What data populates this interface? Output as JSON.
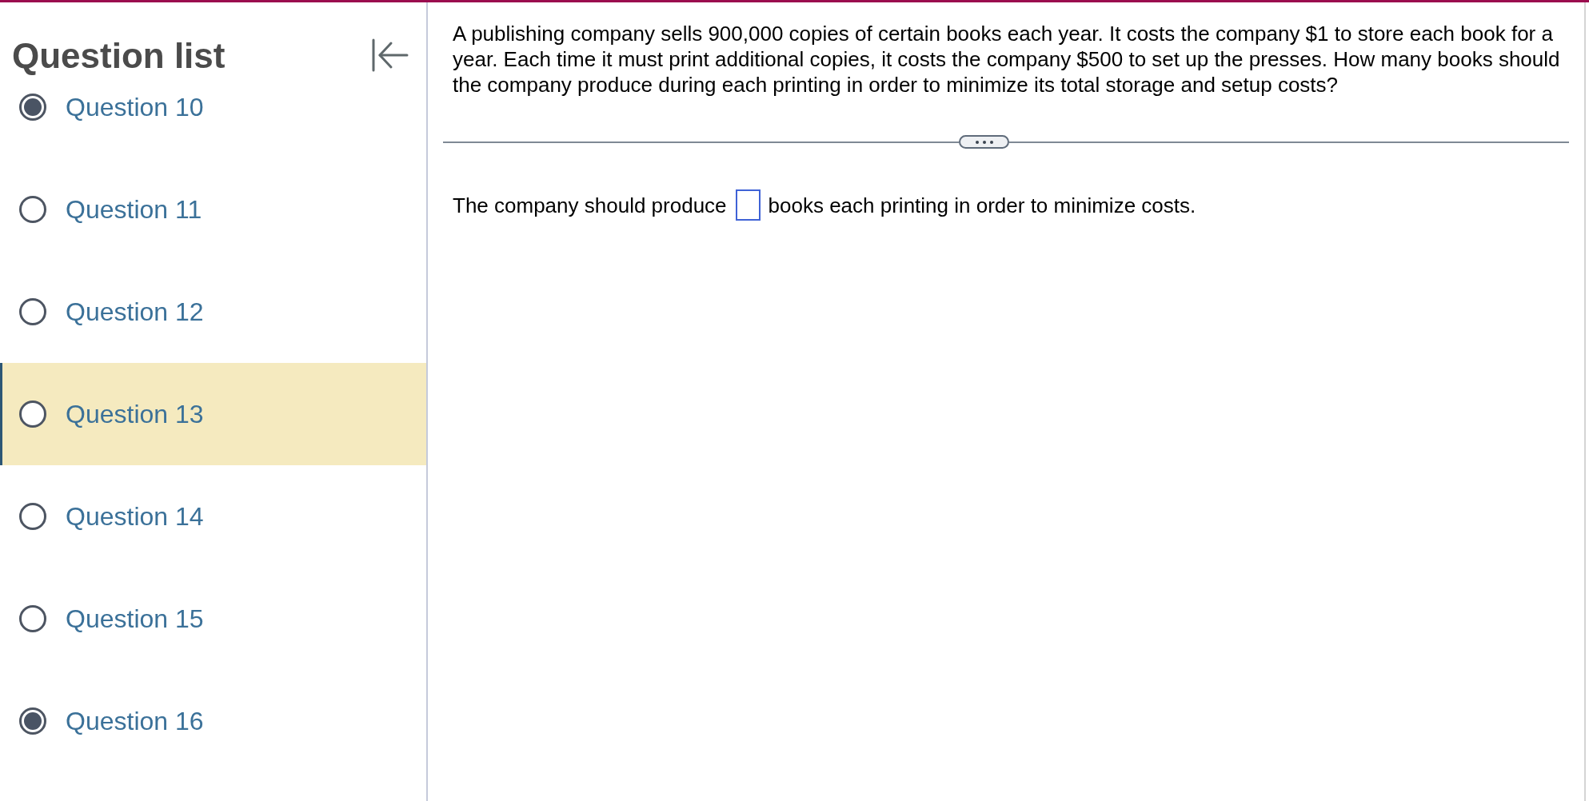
{
  "sidebar": {
    "title": "Question list",
    "questions": [
      {
        "label": "Question 10",
        "completed": true,
        "selected": false
      },
      {
        "label": "Question 11",
        "completed": false,
        "selected": false
      },
      {
        "label": "Question 12",
        "completed": false,
        "selected": false
      },
      {
        "label": "Question 13",
        "completed": false,
        "selected": true
      },
      {
        "label": "Question 14",
        "completed": false,
        "selected": false
      },
      {
        "label": "Question 15",
        "completed": false,
        "selected": false
      },
      {
        "label": "Question 16",
        "completed": true,
        "selected": false
      }
    ]
  },
  "question": {
    "text": "A publishing company sells 900,000 copies of certain books each year. It costs the company $1 to store each book for a year. Each time it must print additional copies, it costs the company $500 to set up the presses. How many books should the company produce during each printing in order to minimize its total storage and setup costs?",
    "answer_prompt": {
      "before": "The company should produce",
      "after": "books each printing in order to minimize costs."
    }
  }
}
